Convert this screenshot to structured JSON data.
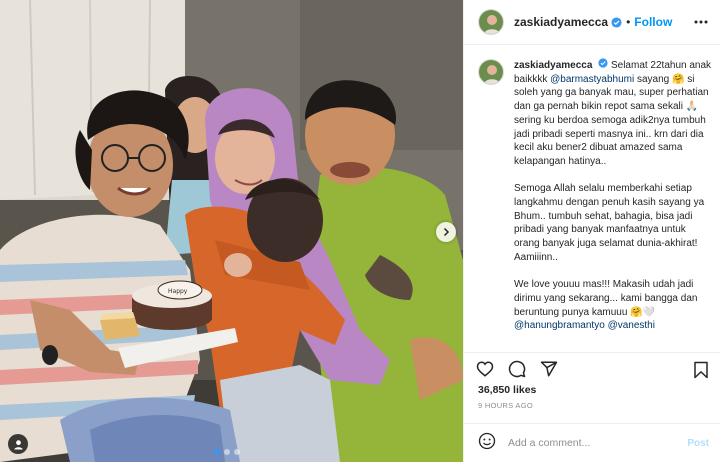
{
  "post": {
    "username": "zaskiadyamecca",
    "follow_label": "Follow",
    "separator": "•",
    "caption": {
      "intro": "Selamat 22tahun anak baikkkk ",
      "mention1": "@barmastyabhumi",
      "p1_rest": " sayang 🤗 si soleh yang ga banyak mau, super perhatian dan ga pernah bikin repot sama sekali 🙏🏻 sering ku berdoa semoga adik2nya tumbuh jadi pribadi seperti masnya ini.. krn dari dia kecil aku bener2 dibuat amazed sama kelapangan hatinya..",
      "p2": "Semoga Allah selalu memberkahi setiap langkahmu dengan penuh kasih sayang ya Bhum.. tumbuh sehat, bahagia, bisa jadi pribadi yang banyak manfaatnya untuk orang banyak juga selamat dunia-akhirat! Aamiiinn..",
      "p3_start": "We love youuu mas!!! Makasih udah jadi dirimu yang sekarang... kami bangga dan beruntung punya kamuuu 🤗🤍 ",
      "mention2": "@hanungbramantyo",
      "mention3": "@vanesthi"
    },
    "likes": "36,850 likes",
    "time": "9 HOURS AGO",
    "comment_placeholder": "Add a comment...",
    "post_label": "Post",
    "carousel": {
      "count": 3,
      "active_index": 0
    }
  },
  "icons": {
    "verified": "verified-badge-icon",
    "more": "more-options-icon",
    "like": "heart-icon",
    "comment": "comment-icon",
    "share": "share-icon",
    "save": "bookmark-icon",
    "emoji": "emoji-icon",
    "next": "chevron-right-icon",
    "tag": "person-tag-icon"
  },
  "colors": {
    "accent": "#0095f6",
    "verified": "#3897f0",
    "mention": "#00376b",
    "muted": "#8e8e8e",
    "post_disabled": "#b2dffc"
  }
}
